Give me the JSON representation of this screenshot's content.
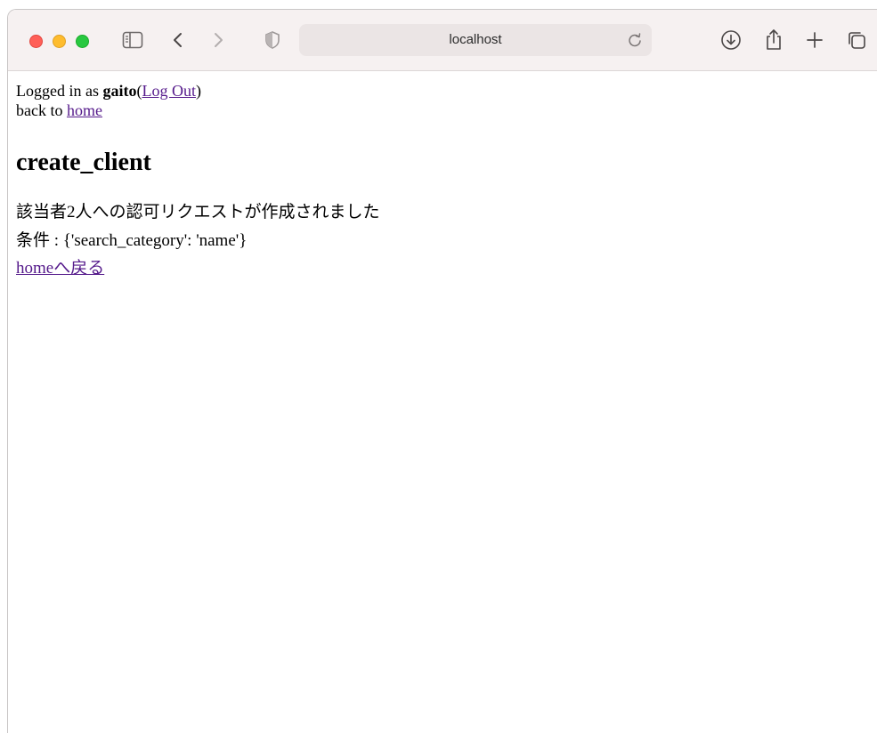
{
  "browser": {
    "url": "localhost",
    "icons": {
      "sidebar": "sidebar-icon",
      "back": "chevron-left-icon",
      "forward": "chevron-right-icon",
      "shield": "shield-icon",
      "reload": "reload-icon",
      "download": "download-icon",
      "share": "share-icon",
      "new_tab": "plus-icon",
      "tabs": "tabs-overview-icon"
    }
  },
  "header": {
    "logged_in_prefix": "Logged in as ",
    "username": "gaito",
    "open_paren": "(",
    "logout_label": "Log Out",
    "close_paren": ")",
    "back_prefix": "back to ",
    "home_link": "home"
  },
  "main": {
    "title": "create_client",
    "message": "該当者2人への認可リクエストが作成されました",
    "condition": "条件 : {'search_category': 'name'}",
    "home_return_link": "homeへ戻る"
  }
}
